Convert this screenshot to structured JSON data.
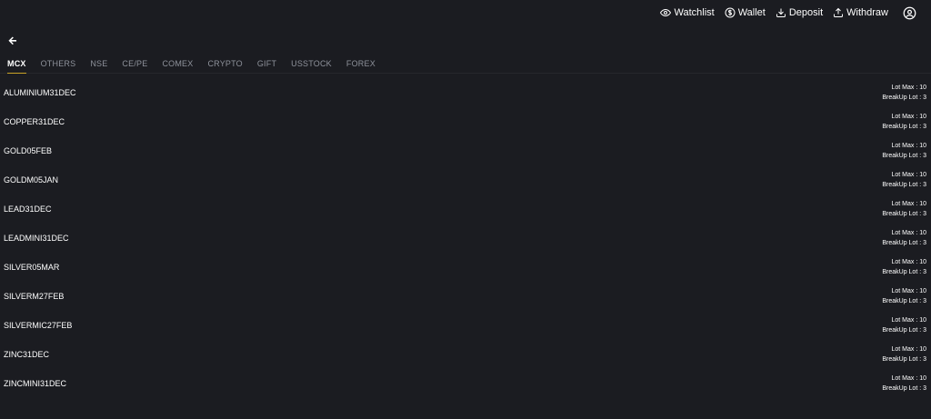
{
  "header": {
    "watchlist_label": "Watchlist",
    "wallet_label": "Wallet",
    "deposit_label": "Deposit",
    "withdraw_label": "Withdraw"
  },
  "tabs": [
    {
      "label": "MCX",
      "active": true
    },
    {
      "label": "OTHERS"
    },
    {
      "label": "NSE"
    },
    {
      "label": "CE/PE"
    },
    {
      "label": "COMEX"
    },
    {
      "label": "CRYPTO"
    },
    {
      "label": "GIFT"
    },
    {
      "label": "USSTOCK"
    },
    {
      "label": "FOREX"
    }
  ],
  "instruments": [
    {
      "symbol": "ALUMINIUM31DEC",
      "lot_max": "Lot Max : 10",
      "breakup": "BreakUp Lot : 3"
    },
    {
      "symbol": "COPPER31DEC",
      "lot_max": "Lot Max : 10",
      "breakup": "BreakUp Lot : 3"
    },
    {
      "symbol": "GOLD05FEB",
      "lot_max": "Lot Max : 10",
      "breakup": "BreakUp Lot : 3"
    },
    {
      "symbol": "GOLDM05JAN",
      "lot_max": "Lot Max : 10",
      "breakup": "BreakUp Lot : 3"
    },
    {
      "symbol": "LEAD31DEC",
      "lot_max": "Lot Max : 10",
      "breakup": "BreakUp Lot : 3"
    },
    {
      "symbol": "LEADMINI31DEC",
      "lot_max": "Lot Max : 10",
      "breakup": "BreakUp Lot : 3"
    },
    {
      "symbol": "SILVER05MAR",
      "lot_max": "Lot Max : 10",
      "breakup": "BreakUp Lot : 3"
    },
    {
      "symbol": "SILVERM27FEB",
      "lot_max": "Lot Max : 10",
      "breakup": "BreakUp Lot : 3"
    },
    {
      "symbol": "SILVERMIC27FEB",
      "lot_max": "Lot Max : 10",
      "breakup": "BreakUp Lot : 3"
    },
    {
      "symbol": "ZINC31DEC",
      "lot_max": "Lot Max : 10",
      "breakup": "BreakUp Lot : 3"
    },
    {
      "symbol": "ZINCMINI31DEC",
      "lot_max": "Lot Max : 10",
      "breakup": "BreakUp Lot : 3"
    }
  ],
  "icons": {
    "watchlist": "eye-icon",
    "wallet": "dollar-circle-icon",
    "deposit": "download-icon",
    "withdraw": "upload-icon",
    "profile": "user-circle-icon",
    "back": "arrow-left-icon"
  },
  "colors": {
    "background": "#1b1c21",
    "active_tab_underline": "#c9a227",
    "inactive_tab": "#8e929b"
  }
}
